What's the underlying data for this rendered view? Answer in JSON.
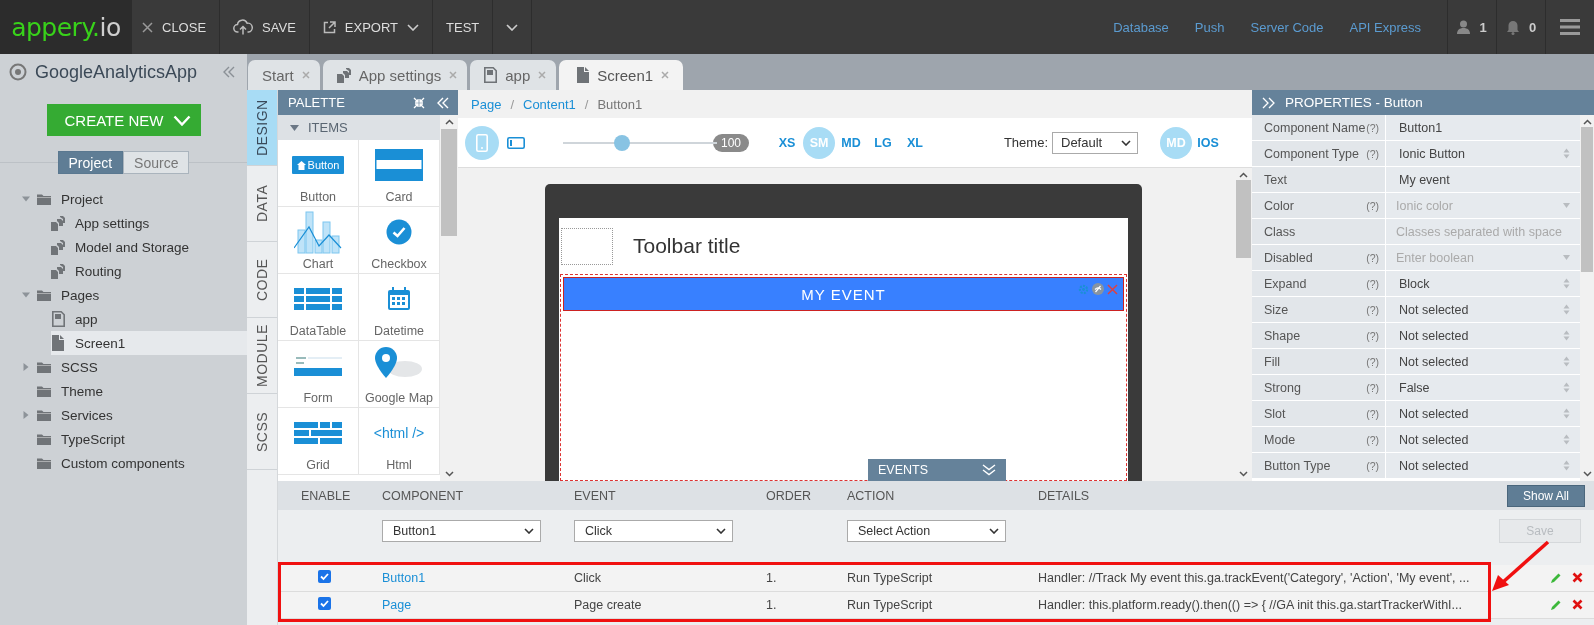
{
  "topbar": {
    "logo": {
      "brand": "appery.",
      "suffix": "io"
    },
    "actions": [
      {
        "kind": "close",
        "label": "CLOSE",
        "caret": false
      },
      {
        "kind": "save",
        "label": "SAVE",
        "caret": false
      },
      {
        "kind": "export",
        "label": "EXPORT",
        "caret": true
      },
      {
        "kind": "test",
        "label": "TEST",
        "caret": false
      },
      {
        "kind": "more",
        "caret": true
      }
    ],
    "links": [
      "Database",
      "Push",
      "Server Code",
      "API Express"
    ],
    "user_count": "1",
    "notification_count": "0"
  },
  "project": {
    "name": "GoogleAnalyticsApp",
    "create_button": "CREATE NEW",
    "view_toggle": [
      {
        "label": "Project",
        "selected": true
      },
      {
        "label": "Source",
        "selected": false
      }
    ],
    "tree": [
      {
        "label": "Project",
        "kind": "folder",
        "expanded": true,
        "selected": false,
        "children": [
          {
            "label": "App settings",
            "kind": "settings",
            "selected": false
          },
          {
            "label": "Model and Storage",
            "kind": "settings",
            "selected": false
          },
          {
            "label": "Routing",
            "kind": "settings",
            "selected": false
          }
        ]
      },
      {
        "label": "Pages",
        "kind": "folder",
        "expanded": true,
        "selected": false,
        "children": [
          {
            "label": "app",
            "kind": "doc",
            "selected": false
          },
          {
            "label": "Screen1",
            "kind": "file",
            "selected": true
          }
        ]
      },
      {
        "label": "SCSS",
        "kind": "folder",
        "expanded": false,
        "selected": false
      },
      {
        "label": "Theme",
        "kind": "folder",
        "selected": false
      },
      {
        "label": "Services",
        "kind": "folder",
        "expanded": false,
        "selected": false
      },
      {
        "label": "TypeScript",
        "kind": "folder",
        "selected": false
      },
      {
        "label": "Custom components",
        "kind": "folder",
        "selected": false
      }
    ]
  },
  "editor_tabs": [
    {
      "label": "Start",
      "kind": "plain",
      "selected": false
    },
    {
      "label": "App settings",
      "kind": "settings",
      "selected": false
    },
    {
      "label": "app",
      "kind": "doc",
      "selected": false
    },
    {
      "label": "Screen1",
      "kind": "file",
      "selected": true
    }
  ],
  "side_tabs": [
    {
      "label": "DESIGN",
      "selected": true
    },
    {
      "label": "DATA",
      "selected": false
    },
    {
      "label": "CODE",
      "selected": false
    },
    {
      "label": "MODULE",
      "selected": false
    },
    {
      "label": "SCSS",
      "selected": false
    }
  ],
  "palette": {
    "title": "PALETTE",
    "section": "ITEMS",
    "expanded": true,
    "items": [
      {
        "kind": "button",
        "label": "Button"
      },
      {
        "kind": "card",
        "label": "Card"
      },
      {
        "kind": "chart",
        "label": "Chart"
      },
      {
        "kind": "checkbox",
        "label": "Checkbox"
      },
      {
        "kind": "datatable",
        "label": "DataTable"
      },
      {
        "kind": "datetime",
        "label": "Datetime"
      },
      {
        "kind": "form",
        "label": "Form"
      },
      {
        "kind": "map",
        "label": "Google Map"
      },
      {
        "kind": "grid",
        "label": "Grid"
      },
      {
        "kind": "html",
        "label": "Html"
      }
    ],
    "previews": [
      {
        "kind": "button",
        "text": "Button"
      },
      {
        "kind": "html",
        "text": "<html />"
      }
    ]
  },
  "canvas": {
    "breadcrumb": [
      {
        "label": "Page",
        "link": true
      },
      {
        "separator": "/",
        "label": "Content1",
        "link": true
      },
      {
        "separator": "/",
        "label": "Button1",
        "link": false
      }
    ],
    "devices": [
      {
        "kind": "phone",
        "selected": true
      },
      {
        "kind": "tablet",
        "selected": false
      }
    ],
    "zoom": {
      "level": 0.38,
      "reading": "100"
    },
    "sizes": [
      {
        "label": "XS",
        "selected": false
      },
      {
        "label": "SM",
        "selected": true
      },
      {
        "label": "MD",
        "selected": false
      },
      {
        "label": "LG",
        "selected": false
      },
      {
        "label": "XL",
        "selected": false
      }
    ],
    "theme": {
      "label": "Theme:",
      "value": "Default"
    },
    "modes": [
      {
        "label": "MD",
        "selected": true
      },
      {
        "label": "IOS",
        "selected": false
      }
    ],
    "preview": {
      "toolbar_title": "Toolbar title",
      "button": "MY EVENT",
      "button_selected": true
    },
    "events_tab": "EVENTS"
  },
  "properties": {
    "title": "PROPERTIES - Button",
    "rows": [
      {
        "name": "Component Name",
        "help": "(?)",
        "value": "Button1",
        "kind": "text"
      },
      {
        "name": "Component Type",
        "help": "(?)",
        "value": "Ionic Button",
        "kind": "select"
      },
      {
        "name": "Text",
        "value": "My event",
        "kind": "text"
      },
      {
        "name": "Color",
        "help": "(?)",
        "placeholder": "Ionic color",
        "kind": "dropdown"
      },
      {
        "name": "Class",
        "placeholder": "Classes separated with space",
        "kind": "text"
      },
      {
        "name": "Disabled",
        "help": "(?)",
        "placeholder": "Enter boolean",
        "kind": "dropdown"
      },
      {
        "name": "Expand",
        "help": "(?)",
        "value": "Block",
        "kind": "select"
      },
      {
        "name": "Size",
        "help": "(?)",
        "value": "Not selected",
        "kind": "select"
      },
      {
        "name": "Shape",
        "help": "(?)",
        "value": "Not selected",
        "kind": "select"
      },
      {
        "name": "Fill",
        "help": "(?)",
        "value": "Not selected",
        "kind": "select"
      },
      {
        "name": "Strong",
        "help": "(?)",
        "value": "False",
        "kind": "select"
      },
      {
        "name": "Slot",
        "help": "(?)",
        "value": "Not selected",
        "kind": "select"
      },
      {
        "name": "Mode",
        "help": "(?)",
        "value": "Not selected",
        "kind": "select"
      },
      {
        "name": "Button Type",
        "help": "(?)",
        "value": "Not selected",
        "kind": "select"
      }
    ]
  },
  "events": {
    "columns": [
      "ENABLE",
      "COMPONENT",
      "EVENT",
      "ORDER",
      "ACTION",
      "DETAILS"
    ],
    "show_all": "Show All",
    "filters": [
      {
        "value": "Button1"
      },
      {
        "value": "Click"
      },
      {
        "value": "Select Action"
      }
    ],
    "save": {
      "label": "Save",
      "disabled": true
    },
    "rows": [
      {
        "enabled": true,
        "component": "Button1",
        "event": "Click",
        "order": "1.",
        "action": "Run TypeScript",
        "details": "Handler: //Track My event this.ga.trackEvent('Category', 'Action', 'My event', ..."
      },
      {
        "enabled": true,
        "component": "Page",
        "event": "Page create",
        "order": "1.",
        "action": "Run TypeScript",
        "details": "Handler: this.platform.ready().then(() => { //GA init this.ga.startTrackerWithI..."
      }
    ],
    "highlight": true
  }
}
